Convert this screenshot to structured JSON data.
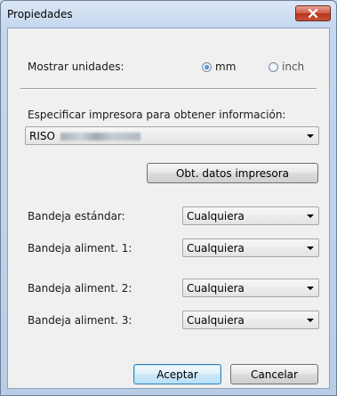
{
  "window": {
    "title": "Propiedades"
  },
  "units": {
    "label": "Mostrar unidades:",
    "options": [
      {
        "label": "mm",
        "selected": true
      },
      {
        "label": "inch",
        "selected": false
      }
    ]
  },
  "printer": {
    "label": "Especificar impresora para obtener información:",
    "selected": "RISO",
    "get_data_button": "Obt. datos impresora"
  },
  "trays": [
    {
      "label": "Bandeja estándar:",
      "value": "Cualquiera"
    },
    {
      "label": "Bandeja aliment. 1:",
      "value": "Cualquiera"
    },
    {
      "label": "Bandeja aliment. 2:",
      "value": "Cualquiera"
    },
    {
      "label": "Bandeja aliment. 3:",
      "value": "Cualquiera"
    }
  ],
  "buttons": {
    "ok": "Aceptar",
    "cancel": "Cancelar"
  }
}
